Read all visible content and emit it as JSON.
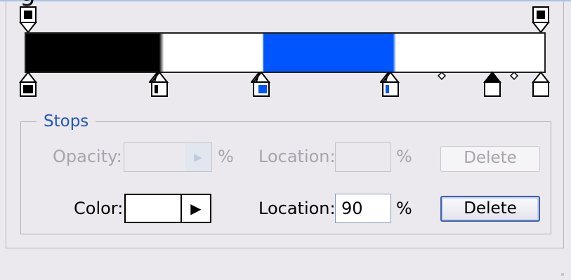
{
  "header": {
    "title_fragment": "g"
  },
  "stops": {
    "legend": "Stops",
    "opacity_label": "Opacity:",
    "opacity_value": "",
    "opacity_pct": "%",
    "opacity_location_label": "Location:",
    "opacity_location_value": "",
    "opacity_location_pct": "%",
    "opacity_delete": "Delete",
    "color_label": "Color:",
    "color_value": "#ffffff",
    "color_location_label": "Location:",
    "color_location_value": "90",
    "color_location_pct": "%",
    "color_delete": "Delete"
  },
  "gradient": {
    "colors": {
      "black": "#000000",
      "blue": "#0055ff",
      "white": "#ffffff"
    },
    "opacity_stops": [
      {
        "name": "opacity-stop-start",
        "location_pct": 0
      },
      {
        "name": "opacity-stop-end",
        "location_pct": 100
      }
    ],
    "color_stops": [
      {
        "name": "color-stop-black",
        "color": "#000000",
        "location_pct": 0
      },
      {
        "name": "color-stop-black-end",
        "color": "#ffffff",
        "location_pct": 26
      },
      {
        "name": "color-stop-blue",
        "color": "#0055ff",
        "location_pct": 46
      },
      {
        "name": "color-stop-blue-end",
        "color": "#ffffff",
        "location_pct": 71
      },
      {
        "name": "color-stop-selected",
        "color": "#ffffff",
        "location_pct": 90,
        "selected": true
      },
      {
        "name": "color-stop-end",
        "color": "#ffffff",
        "location_pct": 100
      }
    ]
  },
  "colors": {
    "legend": "#2456b8",
    "disabled_text": "#a7a4ac",
    "panel_bg": "#ebe9ed"
  }
}
